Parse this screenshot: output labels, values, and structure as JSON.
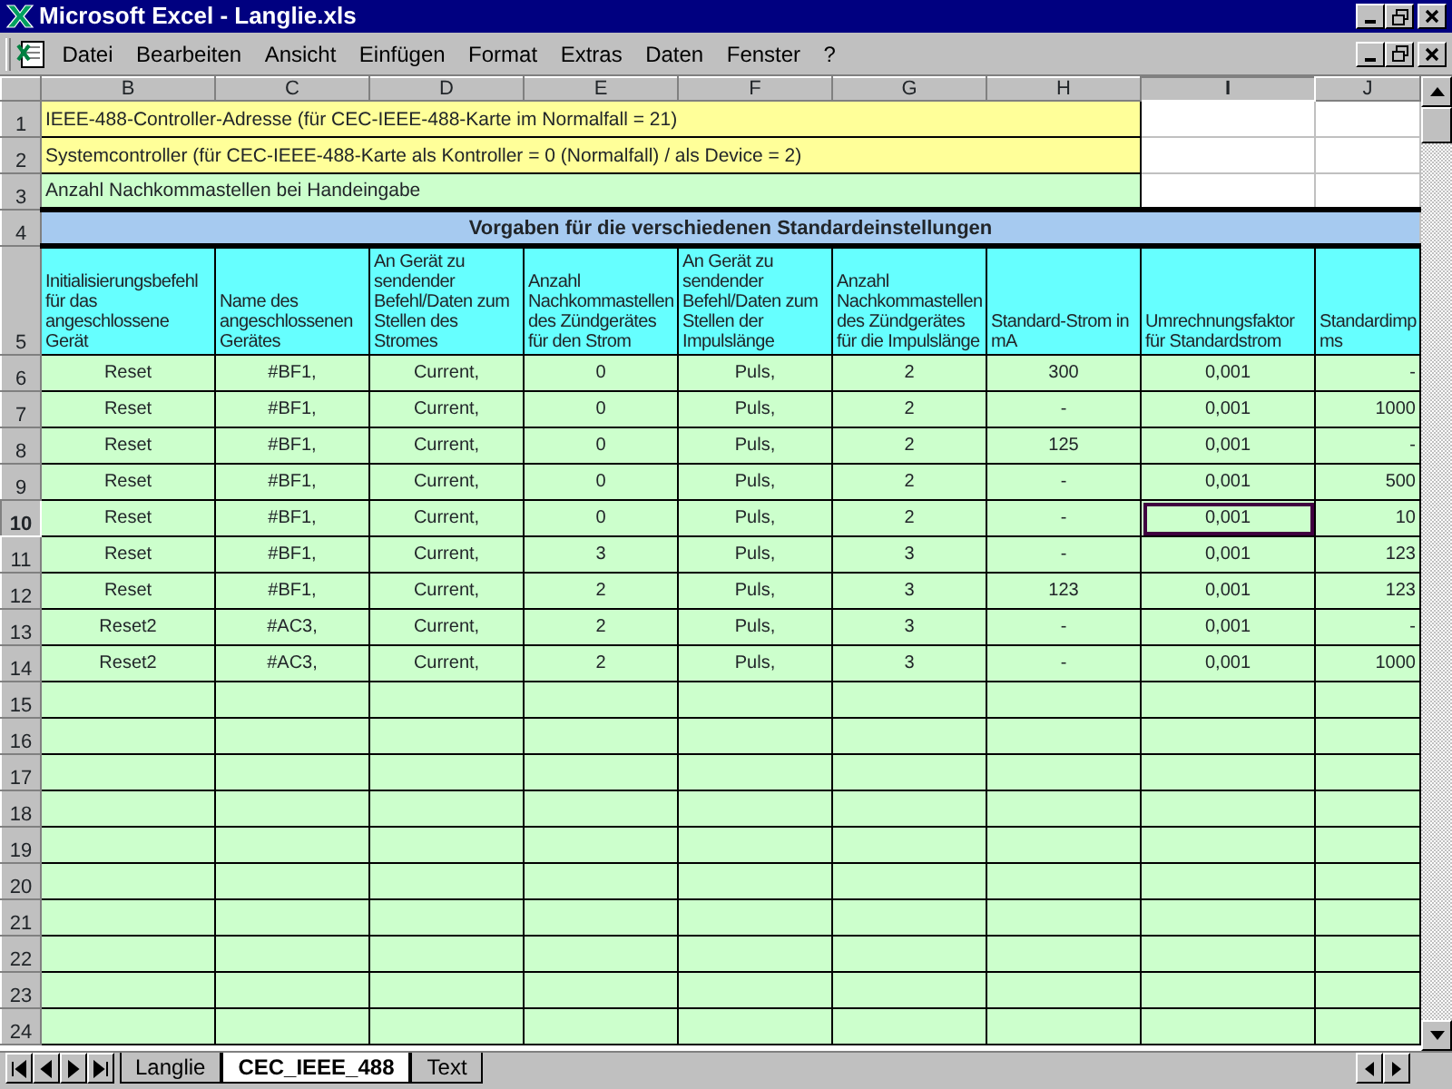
{
  "window": {
    "title": "Microsoft Excel - Langlie.xls"
  },
  "menu": [
    {
      "label": "Datei"
    },
    {
      "label": "Bearbeiten"
    },
    {
      "label": "Ansicht"
    },
    {
      "label": "Einfügen"
    },
    {
      "label": "Format"
    },
    {
      "label": "Extras"
    },
    {
      "label": "Daten"
    },
    {
      "label": "Fenster"
    },
    {
      "label": "?"
    }
  ],
  "column_headers": [
    {
      "label": "B",
      "selected": false
    },
    {
      "label": "C",
      "selected": false
    },
    {
      "label": "D",
      "selected": false
    },
    {
      "label": "E",
      "selected": false
    },
    {
      "label": "F",
      "selected": false
    },
    {
      "label": "G",
      "selected": false
    },
    {
      "label": "H",
      "selected": false
    },
    {
      "label": "I",
      "selected": true
    },
    {
      "label": "J",
      "selected": false
    }
  ],
  "info_rows": [
    {
      "row": "1",
      "text": "IEEE-488-Controller-Adresse (für CEC-IEEE-488-Karte im Normalfall = 21)",
      "color": "#ffff99"
    },
    {
      "row": "2",
      "text": "Systemcontroller (für CEC-IEEE-488-Karte als Kontroller = 0 (Normalfall) / als Device = 2)",
      "color": "#ffff99"
    },
    {
      "row": "3",
      "text": "Anzahl Nachkommastellen bei Handeingabe",
      "color": "#ccffcc"
    }
  ],
  "section_row": {
    "row": "4",
    "text": "Vorgaben für die verschiedenen Standardeinstellungen"
  },
  "header_row": {
    "row": "5",
    "cells": [
      "Initialisierungsbefehl für das angeschlossene Gerät",
      "Name des angeschlossenen Gerätes",
      "An Gerät zu sendender Befehl/Daten zum Stellen des Stromes",
      "Anzahl Nachkommastellen des Zündgerätes für den Strom",
      "An Gerät zu sendender Befehl/Daten zum Stellen der Impulslänge",
      "Anzahl Nachkommastellen des Zündgerätes für die Impulslänge",
      "Standard-Strom in mA",
      "Umrechnungsfaktor für Standardstrom",
      "Standardimp ms"
    ]
  },
  "data_rows": [
    {
      "row": "6",
      "selected": false,
      "cells": [
        {
          "text": "Reset",
          "selected": false
        },
        {
          "text": "#BF1,",
          "selected": false
        },
        {
          "text": "Current,",
          "selected": false
        },
        {
          "text": "0",
          "selected": false
        },
        {
          "text": "Puls,",
          "selected": false
        },
        {
          "text": "2",
          "selected": false
        },
        {
          "text": "300",
          "selected": false
        },
        {
          "text": "0,001",
          "selected": false
        },
        {
          "text": "-",
          "selected": false
        }
      ]
    },
    {
      "row": "7",
      "selected": false,
      "cells": [
        {
          "text": "Reset",
          "selected": false
        },
        {
          "text": "#BF1,",
          "selected": false
        },
        {
          "text": "Current,",
          "selected": false
        },
        {
          "text": "0",
          "selected": false
        },
        {
          "text": "Puls,",
          "selected": false
        },
        {
          "text": "2",
          "selected": false
        },
        {
          "text": "-",
          "selected": false
        },
        {
          "text": "0,001",
          "selected": false
        },
        {
          "text": "1000",
          "selected": false
        }
      ]
    },
    {
      "row": "8",
      "selected": false,
      "cells": [
        {
          "text": "Reset",
          "selected": false
        },
        {
          "text": "#BF1,",
          "selected": false
        },
        {
          "text": "Current,",
          "selected": false
        },
        {
          "text": "0",
          "selected": false
        },
        {
          "text": "Puls,",
          "selected": false
        },
        {
          "text": "2",
          "selected": false
        },
        {
          "text": "125",
          "selected": false
        },
        {
          "text": "0,001",
          "selected": false
        },
        {
          "text": "-",
          "selected": false
        }
      ]
    },
    {
      "row": "9",
      "selected": false,
      "cells": [
        {
          "text": "Reset",
          "selected": false
        },
        {
          "text": "#BF1,",
          "selected": false
        },
        {
          "text": "Current,",
          "selected": false
        },
        {
          "text": "0",
          "selected": false
        },
        {
          "text": "Puls,",
          "selected": false
        },
        {
          "text": "2",
          "selected": false
        },
        {
          "text": "-",
          "selected": false
        },
        {
          "text": "0,001",
          "selected": false
        },
        {
          "text": "500",
          "selected": false
        }
      ]
    },
    {
      "row": "10",
      "selected": true,
      "cells": [
        {
          "text": "Reset",
          "selected": false
        },
        {
          "text": "#BF1,",
          "selected": false
        },
        {
          "text": "Current,",
          "selected": false
        },
        {
          "text": "0",
          "selected": false
        },
        {
          "text": "Puls,",
          "selected": false
        },
        {
          "text": "2",
          "selected": false
        },
        {
          "text": "-",
          "selected": false
        },
        {
          "text": "0,001",
          "selected": true
        },
        {
          "text": "10",
          "selected": false
        }
      ]
    },
    {
      "row": "11",
      "selected": false,
      "cells": [
        {
          "text": "Reset",
          "selected": false
        },
        {
          "text": "#BF1,",
          "selected": false
        },
        {
          "text": "Current,",
          "selected": false
        },
        {
          "text": "3",
          "selected": false
        },
        {
          "text": "Puls,",
          "selected": false
        },
        {
          "text": "3",
          "selected": false
        },
        {
          "text": "-",
          "selected": false
        },
        {
          "text": "0,001",
          "selected": false
        },
        {
          "text": "123",
          "selected": false
        }
      ]
    },
    {
      "row": "12",
      "selected": false,
      "cells": [
        {
          "text": "Reset",
          "selected": false
        },
        {
          "text": "#BF1,",
          "selected": false
        },
        {
          "text": "Current,",
          "selected": false
        },
        {
          "text": "2",
          "selected": false
        },
        {
          "text": "Puls,",
          "selected": false
        },
        {
          "text": "3",
          "selected": false
        },
        {
          "text": "123",
          "selected": false
        },
        {
          "text": "0,001",
          "selected": false
        },
        {
          "text": "123",
          "selected": false
        }
      ]
    },
    {
      "row": "13",
      "selected": false,
      "cells": [
        {
          "text": "Reset2",
          "selected": false
        },
        {
          "text": "#AC3,",
          "selected": false
        },
        {
          "text": "Current,",
          "selected": false
        },
        {
          "text": "2",
          "selected": false
        },
        {
          "text": "Puls,",
          "selected": false
        },
        {
          "text": "3",
          "selected": false
        },
        {
          "text": "-",
          "selected": false
        },
        {
          "text": "0,001",
          "selected": false
        },
        {
          "text": "-",
          "selected": false
        }
      ]
    },
    {
      "row": "14",
      "selected": false,
      "cells": [
        {
          "text": "Reset2",
          "selected": false
        },
        {
          "text": "#AC3,",
          "selected": false
        },
        {
          "text": "Current,",
          "selected": false
        },
        {
          "text": "2",
          "selected": false
        },
        {
          "text": "Puls,",
          "selected": false
        },
        {
          "text": "3",
          "selected": false
        },
        {
          "text": "-",
          "selected": false
        },
        {
          "text": "0,001",
          "selected": false
        },
        {
          "text": "1000",
          "selected": false
        }
      ]
    }
  ],
  "empty_rows": [
    "15",
    "16",
    "17",
    "18",
    "19",
    "20",
    "21",
    "22",
    "23",
    "24"
  ],
  "sheet_tabs": [
    {
      "label": "Langlie",
      "selected": false
    },
    {
      "label": "CEC_IEEE_488",
      "selected": true
    },
    {
      "label": "Text",
      "selected": false
    }
  ]
}
